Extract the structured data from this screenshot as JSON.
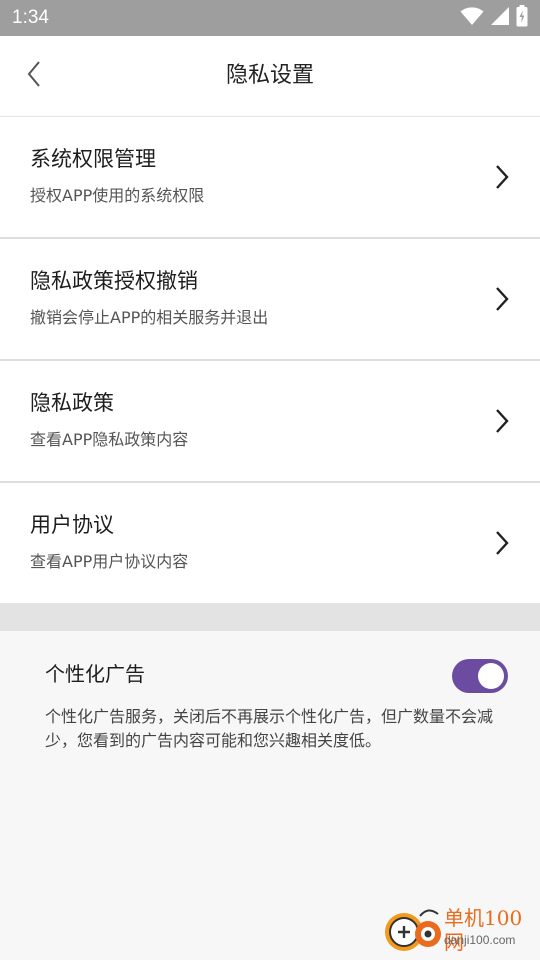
{
  "status_bar": {
    "time": "1:34"
  },
  "header": {
    "title": "隐私设置"
  },
  "menu": {
    "items": [
      {
        "title": "系统权限管理",
        "description": "授权APP使用的系统权限"
      },
      {
        "title": "隐私政策授权撤销",
        "description": "撤销会停止APP的相关服务并退出"
      },
      {
        "title": "隐私政策",
        "description": "查看APP隐私政策内容"
      },
      {
        "title": "用户协议",
        "description": "查看APP用户协议内容"
      }
    ]
  },
  "ads": {
    "title": "个性化广告",
    "enabled": true,
    "description": "个性化广告服务，关闭后不再展示个性化广告，但广数量不会减少，您看到的广告内容可能和您兴趣相关度低。"
  },
  "watermark": {
    "site_name": "单机100网",
    "domain": "danji100.com"
  },
  "colors": {
    "toggle_on": "#6b4ca0",
    "status_bar": "#9e9e9e",
    "watermark_accent": "#e86b1e"
  },
  "icons": {
    "back": "chevron-left-icon",
    "item_arrow": "chevron-right-icon",
    "wifi": "wifi-icon",
    "signal": "signal-icon",
    "battery": "battery-charging-icon"
  }
}
